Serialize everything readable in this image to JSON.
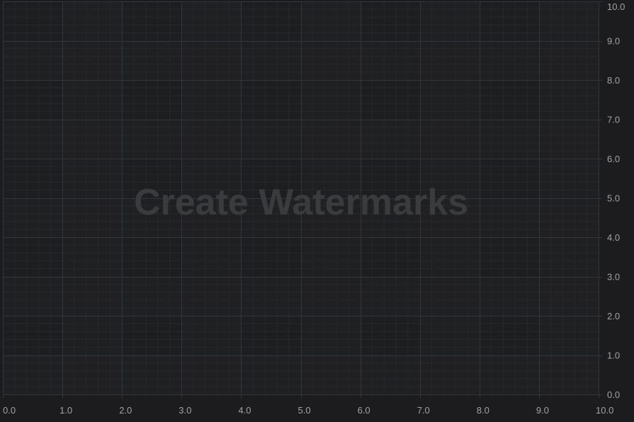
{
  "chart_data": {
    "type": "line",
    "title": "",
    "watermark": "Create Watermarks",
    "xlabel": "",
    "ylabel": "",
    "xlim": [
      0,
      10
    ],
    "ylim": [
      0,
      10
    ],
    "x_ticks": [
      "0.0",
      "1.0",
      "2.0",
      "3.0",
      "4.0",
      "5.0",
      "6.0",
      "7.0",
      "8.0",
      "9.0",
      "10.0"
    ],
    "y_ticks": [
      "0.0",
      "1.0",
      "2.0",
      "3.0",
      "4.0",
      "5.0",
      "6.0",
      "7.0",
      "8.0",
      "9.0",
      "10.0"
    ],
    "y_axis_position": "right",
    "grid": true,
    "series": [],
    "colors": {
      "background": "#1c1c1e",
      "band": "#202123",
      "major_grid": "#323539",
      "minor_grid": "#26282a",
      "label": "#a3a3a3"
    }
  }
}
